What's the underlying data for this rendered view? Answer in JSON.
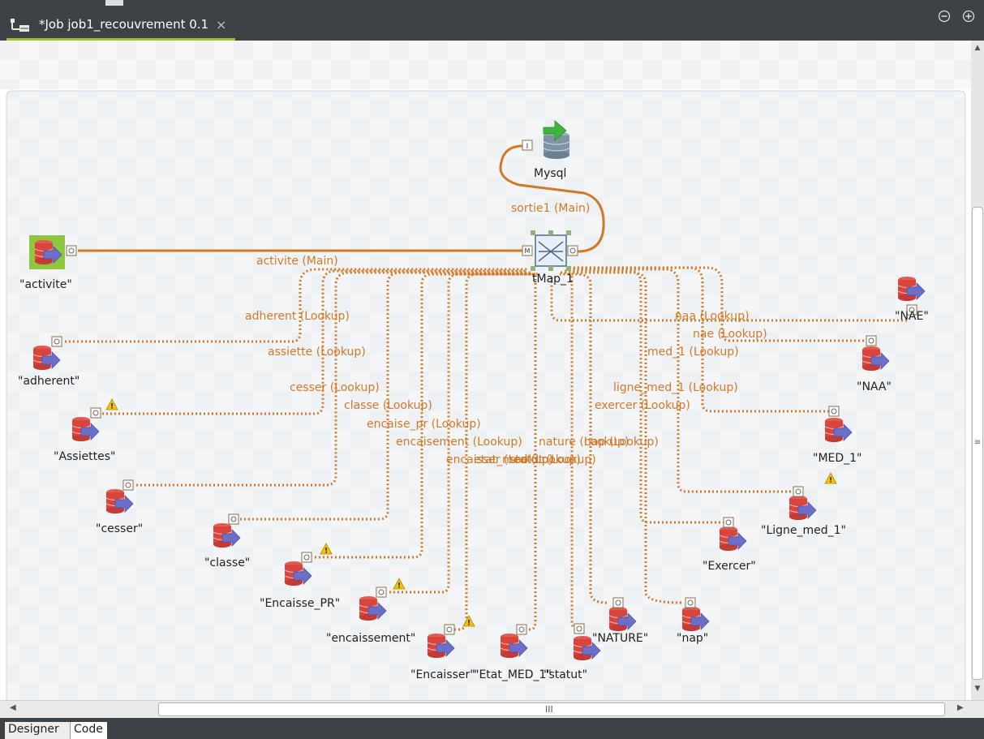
{
  "tab": {
    "title": "*Job job1_recouvrement 0.1",
    "close_glyph": "×",
    "icon": "job-tree-icon"
  },
  "window_controls": {
    "minimize_icon": "minimize-icon",
    "maximize_icon": "maximize-icon"
  },
  "colors": {
    "link": "#d07a28",
    "db_red": "#d9443c",
    "arrow_blue": "#6b6fc7",
    "accent_green": "#9fbf3b"
  },
  "diagram": {
    "source": {
      "label": "\"activite\"",
      "port": "O"
    },
    "tmap": {
      "label": "tMap_1",
      "in_port": "M",
      "out_port": "O"
    },
    "output": {
      "label": "Mysql",
      "port": "I"
    },
    "main_links": [
      {
        "id": "activite",
        "label": "activite (Main)"
      },
      {
        "id": "sortie1",
        "label": "sortie1 (Main)"
      }
    ],
    "lookups": [
      {
        "id": "adherent",
        "label": "\"adherent\"",
        "link": "adherent (Lookup)",
        "warn": false
      },
      {
        "id": "assiettes",
        "label": "\"Assiettes\"",
        "link": "assiette (Lookup)",
        "warn": true
      },
      {
        "id": "cesser",
        "label": "\"cesser\"",
        "link": "cesser (Lookup)",
        "warn": false
      },
      {
        "id": "classe",
        "label": "\"classe\"",
        "link": "classe (Lookup)",
        "warn": false
      },
      {
        "id": "encaisse_pr",
        "label": "\"Encaisse_PR\"",
        "link": "encaise_pr (Lookup)",
        "warn": true
      },
      {
        "id": "encaissement",
        "label": "\"encaissement\"",
        "link": "encaisement (Lookup)",
        "warn": true
      },
      {
        "id": "encaisser",
        "label": "\"Encaisser\"",
        "link": "encaisser (Lookup)",
        "warn": true
      },
      {
        "id": "etat_med_1",
        "label": "\"Etat_MED_1\"",
        "link": "etat_med (Lookup)",
        "warn": false
      },
      {
        "id": "statut",
        "label": "\"statut\"",
        "link": "statut (Lookup)",
        "warn": false
      },
      {
        "id": "nature",
        "label": "\"NATURE\"",
        "link": "nature (Lookup)",
        "warn": false
      },
      {
        "id": "nap",
        "label": "\"nap\"",
        "link": "nap (Lookup)",
        "warn": false
      },
      {
        "id": "exercer",
        "label": "\"Exercer\"",
        "link": "exercer (Lookup)",
        "warn": false
      },
      {
        "id": "ligne_med_1",
        "label": "\"Ligne_med_1\"",
        "link": "ligne_med_1 (Lookup)",
        "warn": true
      },
      {
        "id": "med_1",
        "label": "\"MED_1\"",
        "link": "med_1 (Lookup)",
        "warn": true
      },
      {
        "id": "naa",
        "label": "\"NAA\"",
        "link": "naa (Lookup)",
        "warn": false
      },
      {
        "id": "nae",
        "label": "\"NAE\"",
        "link": "nae (Lookup)",
        "warn": false
      }
    ]
  },
  "scroll": {
    "h_grip": "III",
    "v_grip": "≡"
  },
  "bottom_tabs": {
    "designer": "Designer",
    "code": "Code"
  }
}
